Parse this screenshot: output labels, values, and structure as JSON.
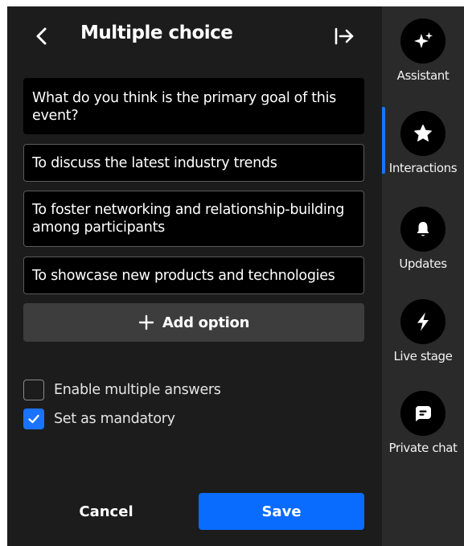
{
  "header": {
    "title": "Multiple choice"
  },
  "question": {
    "text": "What do you think is the primary goal of this event?"
  },
  "options": [
    {
      "text": "To discuss the latest industry trends"
    },
    {
      "text": "To foster networking and relationship-building among participants"
    },
    {
      "text": "To showcase new products and technologies"
    }
  ],
  "add_option": {
    "label": "Add option",
    "icon": "plus-icon"
  },
  "settings": {
    "multiple_answers": {
      "label": "Enable multiple answers",
      "checked": false
    },
    "mandatory": {
      "label": "Set as mandatory",
      "checked": true
    }
  },
  "footer": {
    "cancel_label": "Cancel",
    "save_label": "Save"
  },
  "rail": {
    "active": "Interactions",
    "items": [
      {
        "label": "Assistant",
        "icon": "sparkle-icon"
      },
      {
        "label": "Interactions",
        "icon": "star-icon"
      },
      {
        "label": "Updates",
        "icon": "bell-icon"
      },
      {
        "label": "Live stage",
        "icon": "lightning-icon"
      },
      {
        "label": "Private chat",
        "icon": "chat-icon"
      }
    ]
  },
  "colors": {
    "accent": "#0a6cff",
    "panel_bg": "#1c1c1c",
    "rail_bg": "#2a2a2a",
    "field_bg": "#000000"
  }
}
